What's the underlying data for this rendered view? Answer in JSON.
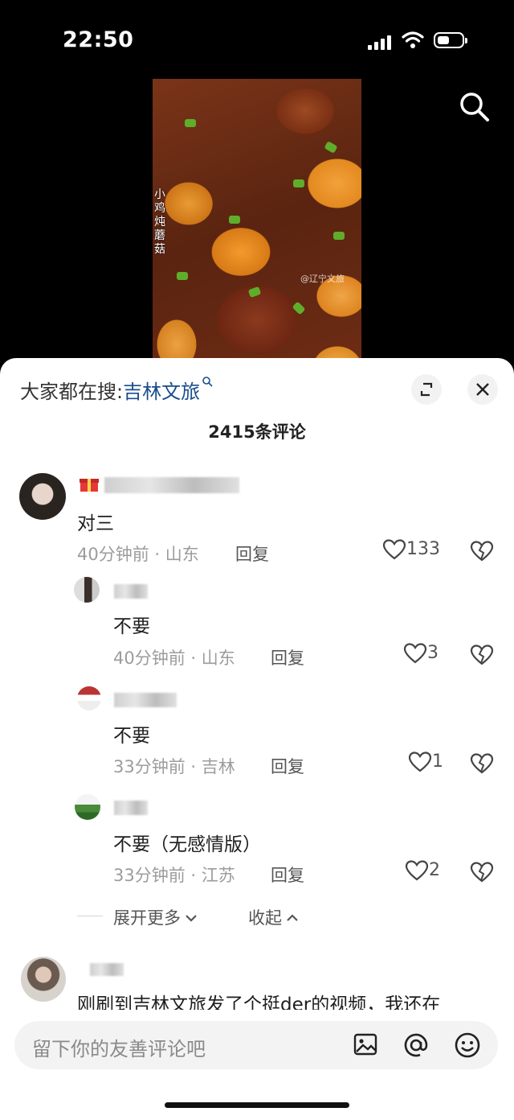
{
  "status_bar": {
    "time": "22:50"
  },
  "video": {
    "caption": "小鸡炖蘑菇",
    "watermark": "@辽宁文旅"
  },
  "sheet": {
    "hot_search_prefix": "大家都在搜:",
    "hot_search_term": "吉林文旅",
    "comment_count": "2415条评论"
  },
  "comments": [
    {
      "text": "对三",
      "meta": "40分钟前 · 山东",
      "reply": "回复",
      "likes": "133"
    },
    {
      "text": "不要",
      "meta": "40分钟前 · 山东",
      "reply": "回复",
      "likes": "3"
    },
    {
      "text": "不要",
      "meta": "33分钟前 · 吉林",
      "reply": "回复",
      "likes": "1"
    },
    {
      "text": "不要（无感情版）",
      "meta": "33分钟前 · 江苏",
      "reply": "回复",
      "likes": "2"
    },
    {
      "text": "刚刷到吉林文旅发了个挺der的视频，我还在"
    }
  ],
  "thread_controls": {
    "expand": "展开更多",
    "collapse": "收起"
  },
  "composer": {
    "placeholder": "留下你的友善评论吧"
  },
  "colors": {
    "link": "#1a4d8c",
    "meta": "#9c9c9c"
  }
}
